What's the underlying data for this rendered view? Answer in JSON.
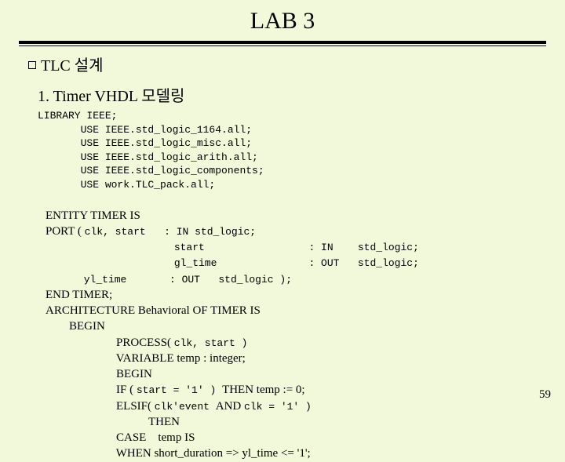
{
  "title": "LAB 3",
  "bullet": {
    "text": "TLC 설계"
  },
  "section": {
    "heading": "1. Timer VHDL 모델링"
  },
  "code_lib": "LIBRARY IEEE;\n       USE IEEE.std_logic_1164.all;\n       USE IEEE.std_logic_misc.all;\n       USE IEEE.std_logic_arith.all;\n       USE IEEE.std_logic_components;\n       USE work.TLC_pack.all;",
  "mixed_block": {
    "l1": "ENTITY TIMER IS",
    "l2a": "PORT ( ",
    "l2b": "clk, start   : IN std_logic;",
    "l3": "                     start                 : IN    std_logic;",
    "l4": "                     gl_time               : OUT   std_logic;",
    "l5a": "             ",
    "l5b": "yl_time       : OUT   std_logic );",
    "l6": "END TIMER;",
    "l7": "ARCHITECTURE Behavioral OF TIMER IS",
    "l8": "        BEGIN",
    "l9": "                        PROCESS( ",
    "l9b": "clk, start )",
    "l10": "                        VARIABLE temp : integer;",
    "l11": "                        BEGIN",
    "l12": "                        IF ( ",
    "l12b": "start = '1' ) ",
    "l12c": "THEN temp := 0;",
    "l13": "                        ELSIF( ",
    "l13b": "clk'event ",
    "l13c": "AND ",
    "l13d": "clk = '1' )",
    "l14": "                                   THEN",
    "l15": "                        CASE    temp IS",
    "l16": "                        WHEN short_duration => yl_time <= '1';"
  },
  "page_number": "59"
}
